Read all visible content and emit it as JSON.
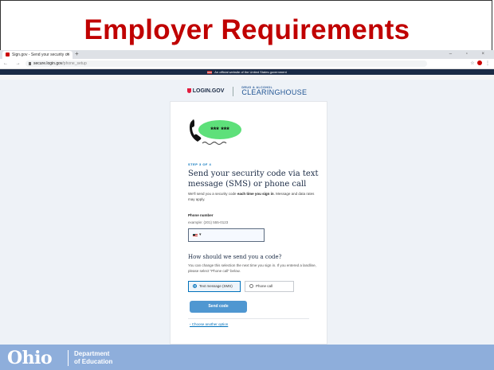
{
  "slide": {
    "title": "Employer Requirements"
  },
  "browser": {
    "tab_title": "Sign.gov - Send your security co",
    "tab_close": "×",
    "new_tab": "+",
    "window_controls": "– ▫ ×",
    "nav": "← → C",
    "url_host": "secure.login.gov",
    "url_path": "/phone_setup"
  },
  "gov_banner": "An official website of the United States government",
  "brand": {
    "login": "LOGIN.GOV",
    "clearinghouse_small": "DRUG & ALCOHOL",
    "clearinghouse": "CLEARINGHOUSE"
  },
  "card": {
    "illustration_text": "*** ***",
    "step": "STEP 3 OF 4",
    "heading": "Send your security code via text message (SMS) or phone call",
    "intro_pre": "We'll send you a security code ",
    "intro_bold": "each time you sign in",
    "intro_post": ". Message and data rates may apply.",
    "phone_label": "Phone number",
    "phone_hint": "example: (201) 555-0123",
    "phone_value": "",
    "subheading": "How should we send you a code?",
    "subtext": "You can change this selection the next time you sign in. If you entered a landline, please select \"Phone call\" below.",
    "options": [
      {
        "label": "Text message (SMS)",
        "selected": true
      },
      {
        "label": "Phone call",
        "selected": false
      }
    ],
    "send_button": "Send code",
    "choose_link": "‹ Choose another option"
  },
  "footer": {
    "logo": "Ohio",
    "dept_line1": "Department",
    "dept_line2": "of Education"
  },
  "colors": {
    "title": "#c00000",
    "footer": "#8eaedb",
    "button": "#4f97d1",
    "link": "#0071bb"
  }
}
